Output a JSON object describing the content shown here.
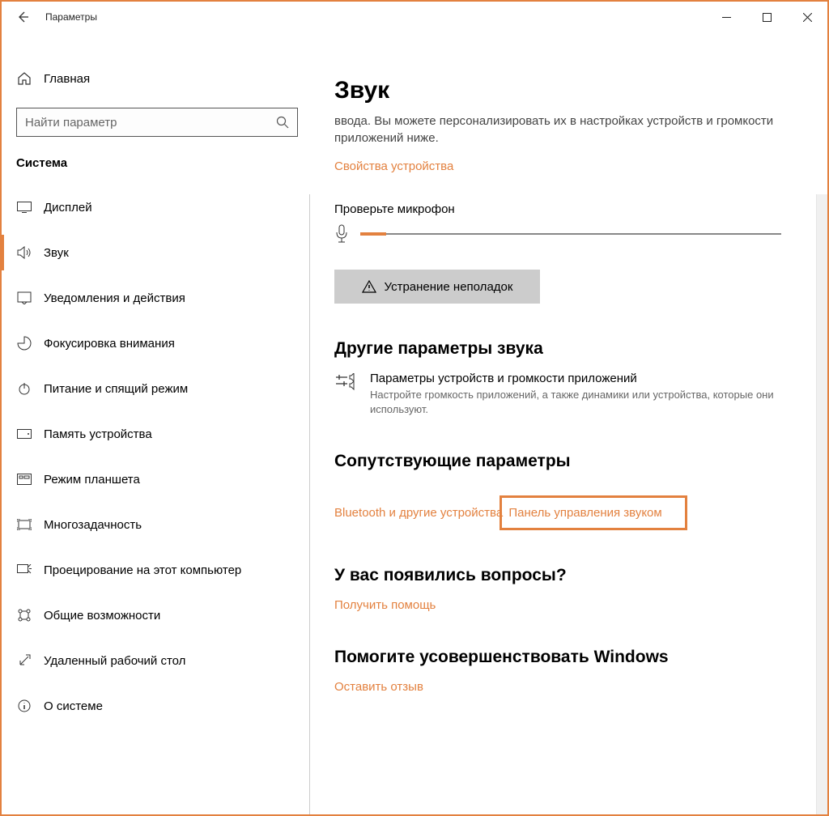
{
  "window": {
    "title": "Параметры"
  },
  "sidebar": {
    "home": "Главная",
    "search_placeholder": "Найти параметр",
    "section": "Система",
    "items": [
      {
        "label": "Дисплей"
      },
      {
        "label": "Звук"
      },
      {
        "label": "Уведомления и действия"
      },
      {
        "label": "Фокусировка внимания"
      },
      {
        "label": "Питание и спящий режим"
      },
      {
        "label": "Память устройства"
      },
      {
        "label": "Режим планшета"
      },
      {
        "label": "Многозадачность"
      },
      {
        "label": "Проецирование на этот компьютер"
      },
      {
        "label": "Общие возможности"
      },
      {
        "label": "Удаленный рабочий стол"
      },
      {
        "label": "О системе"
      }
    ]
  },
  "main": {
    "title": "Звук",
    "intro": "ввода. Вы можете персонализировать их в настройках устройств и громкости приложений ниже.",
    "device_props": "Свойства устройства",
    "mic_check": "Проверьте микрофон",
    "troubleshoot": "Устранение неполадок",
    "other_params": {
      "heading": "Другие параметры звука",
      "row_title": "Параметры устройств и громкости приложений",
      "row_desc": "Настройте громкость приложений, а также динамики или устройства, которые они используют."
    },
    "related": {
      "heading": "Сопутствующие параметры",
      "bluetooth": "Bluetooth и другие устройства",
      "sound_panel": "Панель управления звуком"
    },
    "help": {
      "heading": "У вас появились вопросы?",
      "link": "Получить помощь"
    },
    "feedback": {
      "heading": "Помогите усовершенствовать Windows",
      "link": "Оставить отзыв"
    }
  }
}
